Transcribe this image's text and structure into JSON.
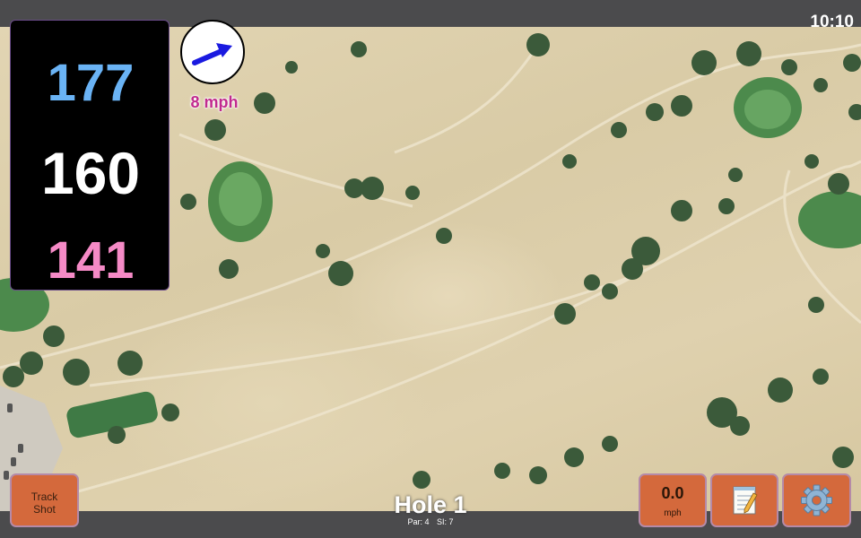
{
  "status": {
    "time": "10:10"
  },
  "distances": {
    "back": "177",
    "middle": "160",
    "front": "141"
  },
  "wind": {
    "speed_label": "8 mph",
    "direction_icon": "arrow-up-right-icon"
  },
  "hole": {
    "title": "Hole 1",
    "par": "Par: 4",
    "si": "SI: 7"
  },
  "buttons": {
    "track_shot_line1": "Track",
    "track_shot_line2": "Shot",
    "speed_value": "0.0",
    "speed_unit": "mph",
    "notes_icon": "notepad-icon",
    "settings_icon": "gear-icon"
  },
  "colors": {
    "back_distance": "#6ab3f5",
    "middle_distance": "#ffffff",
    "front_distance": "#f58ac6",
    "button_fill": "#d4693c",
    "wind_label": "#c12a8e"
  }
}
